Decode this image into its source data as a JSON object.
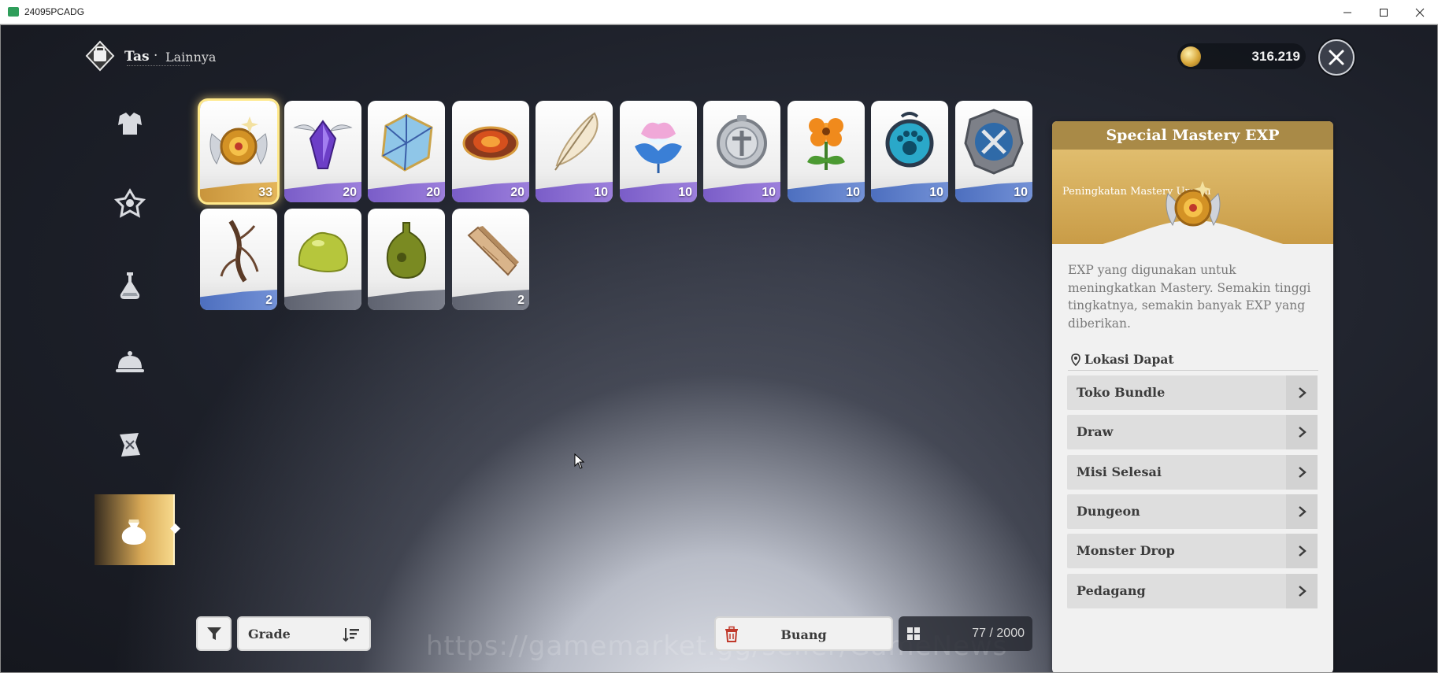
{
  "window": {
    "title": "24095PCADG",
    "minimize_icon": "minimize-icon",
    "maximize_icon": "maximize-icon",
    "close_icon": "close-icon"
  },
  "header": {
    "title": "Tas",
    "separator": "·",
    "subtitle": "Lainnya",
    "currency_value": "316.219"
  },
  "categories": [
    {
      "name": "armor-category-icon",
      "active": false
    },
    {
      "name": "accessory-category-icon",
      "active": false
    },
    {
      "name": "potion-category-icon",
      "active": false
    },
    {
      "name": "food-cloche-category-icon",
      "active": false
    },
    {
      "name": "scroll-category-icon",
      "active": false
    },
    {
      "name": "misc-bag-category-icon",
      "active": true
    }
  ],
  "items": [
    {
      "name": "special-mastery-exp-item",
      "icon": "winged-amber-orb-icon",
      "qty": "33",
      "rarity": "gold",
      "selected": true
    },
    {
      "name": "purple-crystal-item",
      "icon": "winged-purple-gem-icon",
      "qty": "20",
      "rarity": "purple"
    },
    {
      "name": "blue-cube-item",
      "icon": "blue-crystal-cube-icon",
      "qty": "20",
      "rarity": "purple"
    },
    {
      "name": "fire-ring-item",
      "icon": "molten-ring-icon",
      "qty": "20",
      "rarity": "purple"
    },
    {
      "name": "feather-item",
      "icon": "white-feather-icon",
      "qty": "10",
      "rarity": "purple"
    },
    {
      "name": "spirit-flower-item",
      "icon": "glowing-lotus-icon",
      "qty": "10",
      "rarity": "purple"
    },
    {
      "name": "silver-medal-item",
      "icon": "silver-emblem-icon",
      "qty": "10",
      "rarity": "purple"
    },
    {
      "name": "orange-flower-item",
      "icon": "orange-flower-icon",
      "qty": "10",
      "rarity": "blue"
    },
    {
      "name": "paw-amulet-item",
      "icon": "paw-amulet-icon",
      "qty": "10",
      "rarity": "blue"
    },
    {
      "name": "weapon-badge-item",
      "icon": "crossed-weapons-badge-icon",
      "qty": "10",
      "rarity": "blue"
    },
    {
      "name": "root-item",
      "icon": "dry-root-icon",
      "qty": "2",
      "rarity": "blue"
    },
    {
      "name": "slime-item",
      "icon": "green-slime-icon",
      "qty": "",
      "rarity": "gray"
    },
    {
      "name": "gourd-item",
      "icon": "green-gourd-icon",
      "qty": "",
      "rarity": "gray"
    },
    {
      "name": "wood-plank-item",
      "icon": "wood-plank-icon",
      "qty": "2",
      "rarity": "gray"
    }
  ],
  "bottom": {
    "filter_icon": "filter-icon",
    "grade_label": "Grade",
    "sort_icon": "sort-icon",
    "discard_label": "Buang",
    "capacity": "77 / 2000",
    "watermark": "https://gamemarket.gg/seller/GameNews"
  },
  "detail": {
    "title": "Special Mastery EXP",
    "subtitle": "Peningkatan Mastery Umum",
    "description": "EXP yang digunakan untuk meningkatkan Mastery. Semakin tinggi tingkatnya, semakin banyak EXP yang diberikan.",
    "location_heading": "Lokasi Dapat",
    "locations": [
      "Toko Bundle",
      "Draw",
      "Misi Selesai",
      "Dungeon",
      "Monster Drop",
      "Pedagang"
    ]
  },
  "colors": {
    "accent_gold": "#a98a47",
    "rarity_gold": "#d9a84a",
    "rarity_purple": "#8b6fd4",
    "rarity_blue": "#5f80ca",
    "rarity_gray": "#6e7280"
  }
}
